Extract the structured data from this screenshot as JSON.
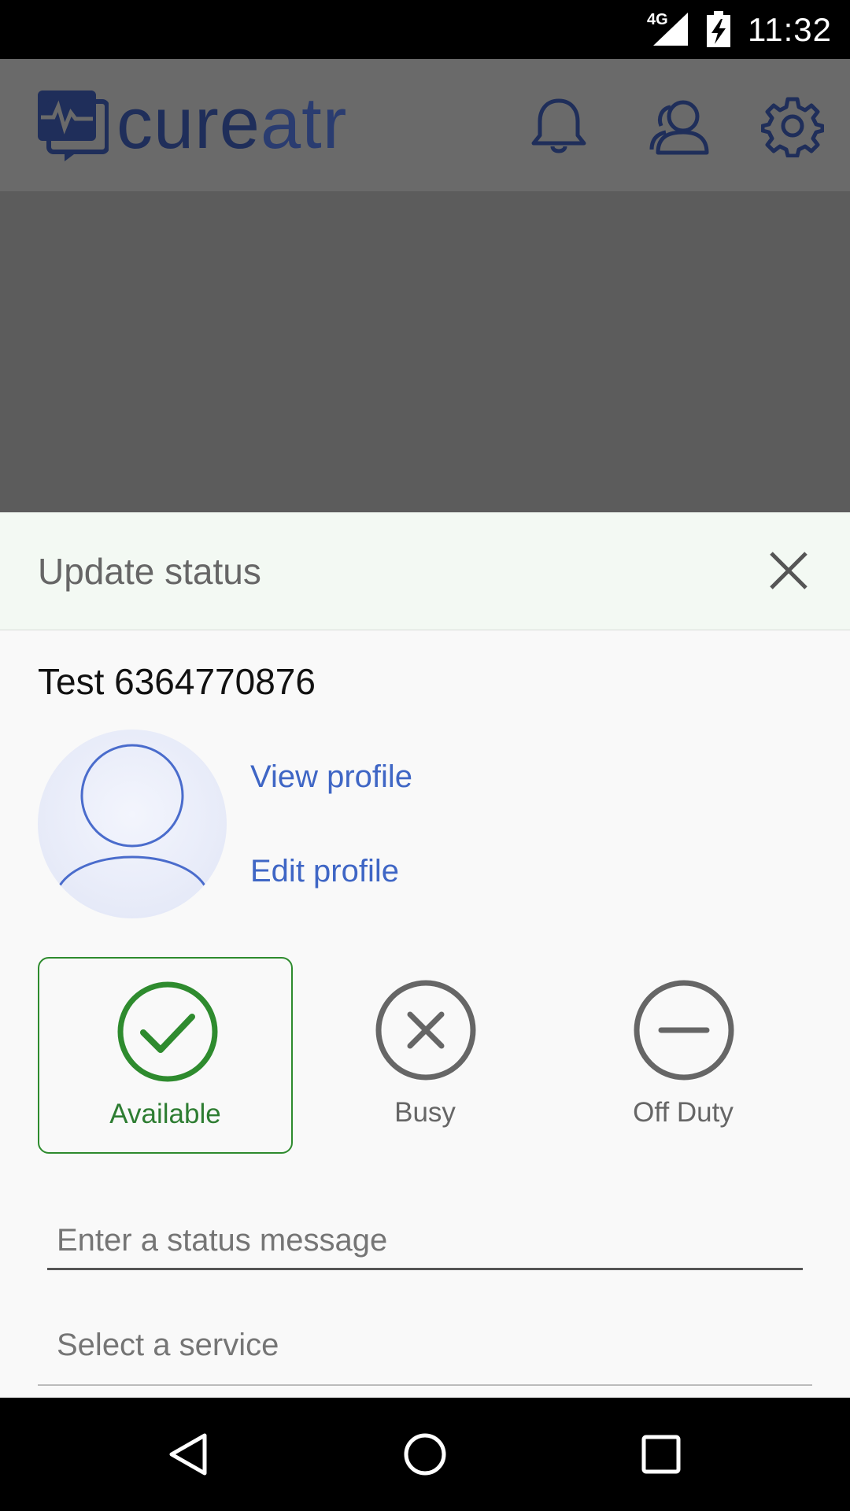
{
  "status_bar": {
    "network": "4G",
    "time": "11:32"
  },
  "header": {
    "logo_text_left": "cure",
    "logo_text_right": "atr",
    "brand_color": "#1f2e5a",
    "icons": [
      "bell-icon",
      "contacts-icon",
      "gear-icon"
    ]
  },
  "sheet": {
    "title": "Update status",
    "user_name": "Test 6364770876",
    "view_profile_label": "View profile",
    "edit_profile_label": "Edit profile",
    "statuses": [
      {
        "label": "Available",
        "icon": "check-circle-icon",
        "selected": true,
        "color": "#2e8b2e"
      },
      {
        "label": "Busy",
        "icon": "x-circle-icon",
        "selected": false,
        "color": "#666666"
      },
      {
        "label": "Off Duty",
        "icon": "minus-circle-icon",
        "selected": false,
        "color": "#666666"
      }
    ],
    "status_message_placeholder": "Enter a status message",
    "service_placeholder": "Select a service",
    "link_color": "#3f66c5"
  },
  "nav": {
    "icons": [
      "back-icon",
      "home-icon",
      "recents-icon"
    ]
  }
}
